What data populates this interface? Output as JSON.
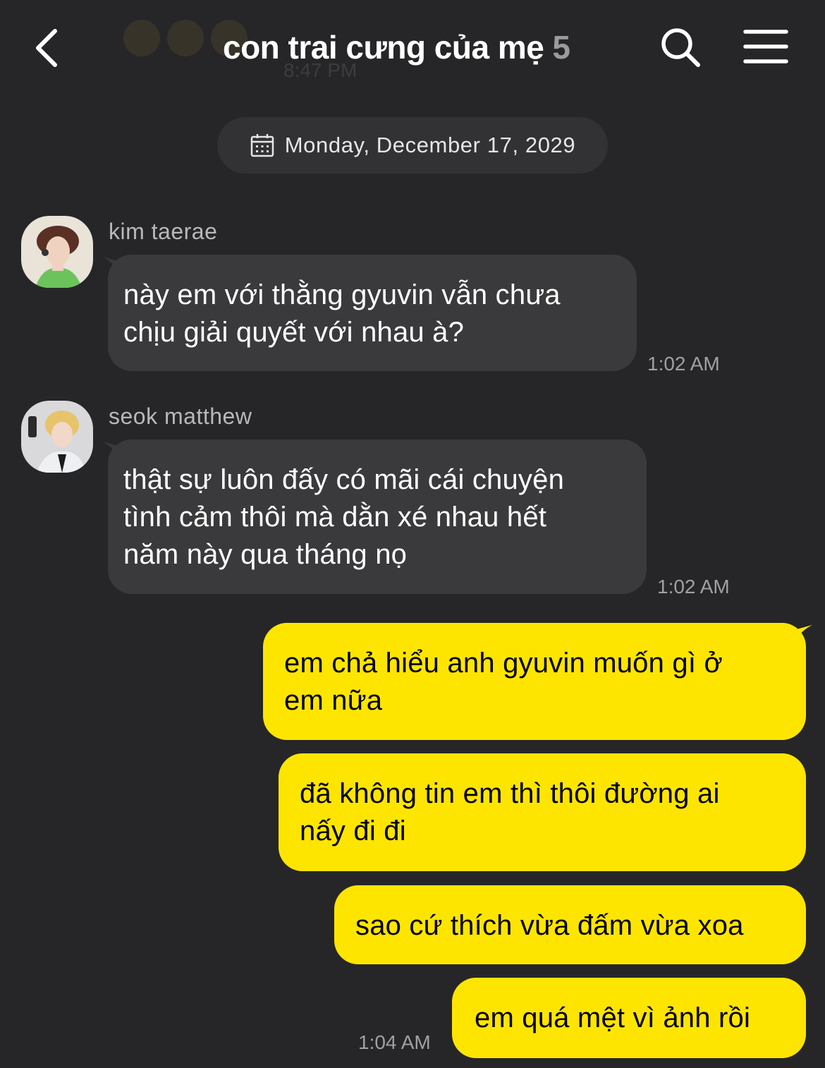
{
  "header": {
    "title": "con trai cưng của mẹ",
    "member_count": "5",
    "ghost_time": "8:47 PM"
  },
  "date_divider": "Monday, December 17, 2029",
  "messages": [
    {
      "sender": "kim taerae",
      "lines": [
        "này em với thằng gyuvin vẫn chưa",
        "chịu giải quyết với nhau à?"
      ],
      "time": "1:02 AM"
    },
    {
      "sender": "seok matthew",
      "lines": [
        "thật sự luôn đấy có mãi cái chuyện",
        "tình cảm thôi mà dằn xé nhau hết",
        "năm này qua tháng nọ"
      ],
      "time": "1:02 AM"
    }
  ],
  "my_messages": [
    {
      "lines": [
        "em chả hiểu anh gyuvin muốn gì ở",
        "em nữa"
      ]
    },
    {
      "lines": [
        "đã không tin em thì thôi đường ai",
        "nấy đi đi"
      ]
    },
    {
      "lines": [
        "sao cứ thích vừa đấm vừa xoa"
      ]
    },
    {
      "lines": [
        "em quá mệt vì ảnh rồi"
      ]
    }
  ],
  "my_last_time": "1:04 AM",
  "colors": {
    "background": "#262628",
    "incoming_bubble": "#3a3a3c",
    "outgoing_bubble": "#fee500"
  },
  "icons": [
    "back-chevron-icon",
    "search-icon",
    "menu-icon",
    "calendar-icon"
  ]
}
